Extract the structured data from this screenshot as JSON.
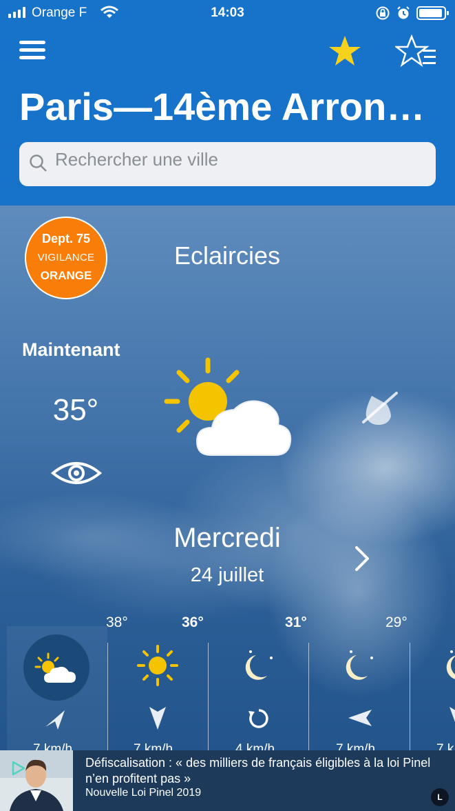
{
  "status_bar": {
    "carrier": "Orange F",
    "time": "14:03"
  },
  "header": {
    "title": "Paris—14ème Arron…",
    "search_placeholder": "Rechercher une ville"
  },
  "vigilance": {
    "line1": "Dept. 75",
    "line2": "VIGILANCE",
    "line3": "ORANGE",
    "color": "#f97e09"
  },
  "current": {
    "condition": "Eclaircies",
    "label": "Maintenant",
    "temperature": "35°"
  },
  "day": {
    "name": "Mercredi",
    "date": "24 juillet"
  },
  "hourly": [
    {
      "temp": "38°",
      "bold": false,
      "icon": "sun-cloud-icon",
      "wind_dir": "north-east-arrow",
      "speed": "7 km/h"
    },
    {
      "temp": "36°",
      "bold": true,
      "icon": "sun-icon",
      "wind_dir": "south-arrow",
      "speed": "7 km/h"
    },
    {
      "temp": "31°",
      "bold": true,
      "icon": "moon-icon",
      "wind_dir": "variable-circle",
      "speed": "4 km/h"
    },
    {
      "temp": "29°",
      "bold": false,
      "icon": "moon-icon",
      "wind_dir": "west-arrow",
      "speed": "7 km/h"
    },
    {
      "temp": "",
      "bold": false,
      "icon": "moon-icon",
      "wind_dir": "south-arrow",
      "speed": "7 k"
    }
  ],
  "ad": {
    "title": "Défiscalisation : « des milliers de français éligibles à la loi Pinel n’en profitent pas »",
    "subtitle": "Nouvelle Loi Pinel 2019",
    "badge": "L"
  },
  "colors": {
    "header_blue": "#1673c9",
    "sun_yellow": "#f5c400",
    "star_yellow": "#f7d21c"
  }
}
